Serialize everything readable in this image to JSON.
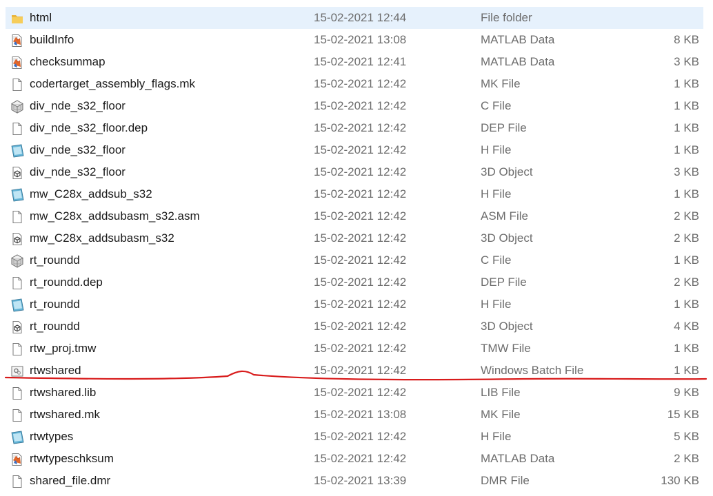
{
  "files": [
    {
      "name": "html",
      "date": "15-02-2021 12:44",
      "type": "File folder",
      "size": "",
      "icon": "folder-icon",
      "selected": true
    },
    {
      "name": "buildInfo",
      "date": "15-02-2021 13:08",
      "type": "MATLAB Data",
      "size": "8 KB",
      "icon": "matlab-data-icon"
    },
    {
      "name": "checksummap",
      "date": "15-02-2021 12:41",
      "type": "MATLAB Data",
      "size": "3 KB",
      "icon": "matlab-data-icon"
    },
    {
      "name": "codertarget_assembly_flags.mk",
      "date": "15-02-2021 12:42",
      "type": "MK File",
      "size": "1 KB",
      "icon": "blank-file-icon"
    },
    {
      "name": "div_nde_s32_floor",
      "date": "15-02-2021 12:42",
      "type": "C File",
      "size": "1 KB",
      "icon": "c-file-icon"
    },
    {
      "name": "div_nde_s32_floor.dep",
      "date": "15-02-2021 12:42",
      "type": "DEP File",
      "size": "1 KB",
      "icon": "blank-file-icon"
    },
    {
      "name": "div_nde_s32_floor",
      "date": "15-02-2021 12:42",
      "type": "H File",
      "size": "1 KB",
      "icon": "h-file-icon"
    },
    {
      "name": "div_nde_s32_floor",
      "date": "15-02-2021 12:42",
      "type": "3D Object",
      "size": "3 KB",
      "icon": "3d-object-icon"
    },
    {
      "name": "mw_C28x_addsub_s32",
      "date": "15-02-2021 12:42",
      "type": "H File",
      "size": "1 KB",
      "icon": "h-file-icon"
    },
    {
      "name": "mw_C28x_addsubasm_s32.asm",
      "date": "15-02-2021 12:42",
      "type": "ASM File",
      "size": "2 KB",
      "icon": "blank-file-icon"
    },
    {
      "name": "mw_C28x_addsubasm_s32",
      "date": "15-02-2021 12:42",
      "type": "3D Object",
      "size": "2 KB",
      "icon": "3d-object-icon"
    },
    {
      "name": "rt_roundd",
      "date": "15-02-2021 12:42",
      "type": "C File",
      "size": "1 KB",
      "icon": "c-file-icon"
    },
    {
      "name": "rt_roundd.dep",
      "date": "15-02-2021 12:42",
      "type": "DEP File",
      "size": "2 KB",
      "icon": "blank-file-icon"
    },
    {
      "name": "rt_roundd",
      "date": "15-02-2021 12:42",
      "type": "H File",
      "size": "1 KB",
      "icon": "h-file-icon"
    },
    {
      "name": "rt_roundd",
      "date": "15-02-2021 12:42",
      "type": "3D Object",
      "size": "4 KB",
      "icon": "3d-object-icon"
    },
    {
      "name": "rtw_proj.tmw",
      "date": "15-02-2021 12:42",
      "type": "TMW File",
      "size": "1 KB",
      "icon": "blank-file-icon"
    },
    {
      "name": "rtwshared",
      "date": "15-02-2021 12:42",
      "type": "Windows Batch File",
      "size": "1 KB",
      "icon": "batch-file-icon"
    },
    {
      "name": "rtwshared.lib",
      "date": "15-02-2021 12:42",
      "type": "LIB File",
      "size": "9 KB",
      "icon": "blank-file-icon"
    },
    {
      "name": "rtwshared.mk",
      "date": "15-02-2021 13:08",
      "type": "MK File",
      "size": "15 KB",
      "icon": "blank-file-icon"
    },
    {
      "name": "rtwtypes",
      "date": "15-02-2021 12:42",
      "type": "H File",
      "size": "5 KB",
      "icon": "h-file-icon"
    },
    {
      "name": "rtwtypeschksum",
      "date": "15-02-2021 12:42",
      "type": "MATLAB Data",
      "size": "2 KB",
      "icon": "matlab-data-icon"
    },
    {
      "name": "shared_file.dmr",
      "date": "15-02-2021 13:39",
      "type": "DMR File",
      "size": "130 KB",
      "icon": "blank-file-icon"
    }
  ],
  "colors": {
    "selection": "#e6f1fc",
    "annotation": "#d81b1b",
    "folder": "#f3c350"
  },
  "annotation": {
    "kind": "freehand-underline",
    "under_file": "rtwshared"
  }
}
